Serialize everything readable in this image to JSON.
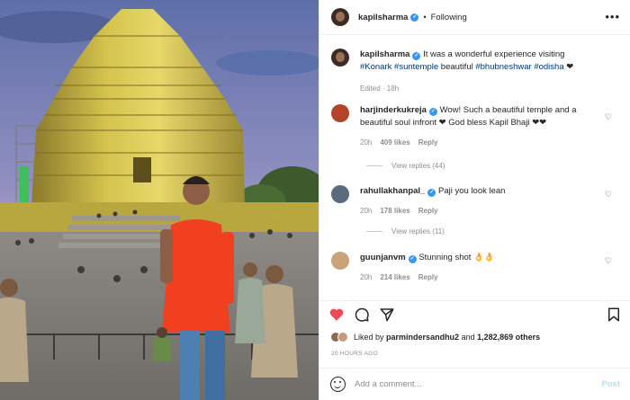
{
  "post": {
    "username": "kapilsharma",
    "follow_state": "Following",
    "more_glyph": "•••",
    "verified_glyph": "✓"
  },
  "caption": {
    "username": "kapilsharma",
    "text_plain_1": "It was a wonderful experience visiting ",
    "tag_1": "#Konark",
    "tag_2": "#suntemple",
    "text_plain_2": " beautiful ",
    "tag_3": "#bhubneshwar",
    "tag_4": "#odisha",
    "text_end": " ❤",
    "meta": "Edited · 18h"
  },
  "comments": [
    {
      "username": "harjinderkukreja",
      "text": "Wow! Such a beautiful temple and a beautiful soul infront ❤ God bless Kapil Bhaji ❤❤",
      "age": "20h",
      "likes": "409 likes",
      "reply": "Reply",
      "replies": "View replies (44)"
    },
    {
      "username": "rahullakhanpal_",
      "text": "Paji you look lean",
      "age": "20h",
      "likes": "178 likes",
      "reply": "Reply",
      "replies": "View replies (11)"
    },
    {
      "username": "guunjanvm",
      "text": "Stunning shot 👌👌",
      "age": "20h",
      "likes": "214 likes",
      "reply": "Reply"
    }
  ],
  "likes_line": {
    "prefix": "Liked by ",
    "user": "parmindersandhu2",
    "mid": " and ",
    "count": "1,282,869 others"
  },
  "timestamp": "20 HOURS AGO",
  "add_comment": {
    "placeholder": "Add a comment...",
    "post_label": "Post"
  },
  "icons": {
    "like": "heart-icon",
    "comment": "comment-icon",
    "share": "share-icon",
    "save": "bookmark-icon",
    "emoji": "emoji-icon"
  },
  "colors": {
    "like_red": "#ed4956",
    "link_blue": "#00376b",
    "verified_blue": "#3897f0",
    "post_disabled": "#b2dffc",
    "shirt_orange": "#f0401f"
  }
}
